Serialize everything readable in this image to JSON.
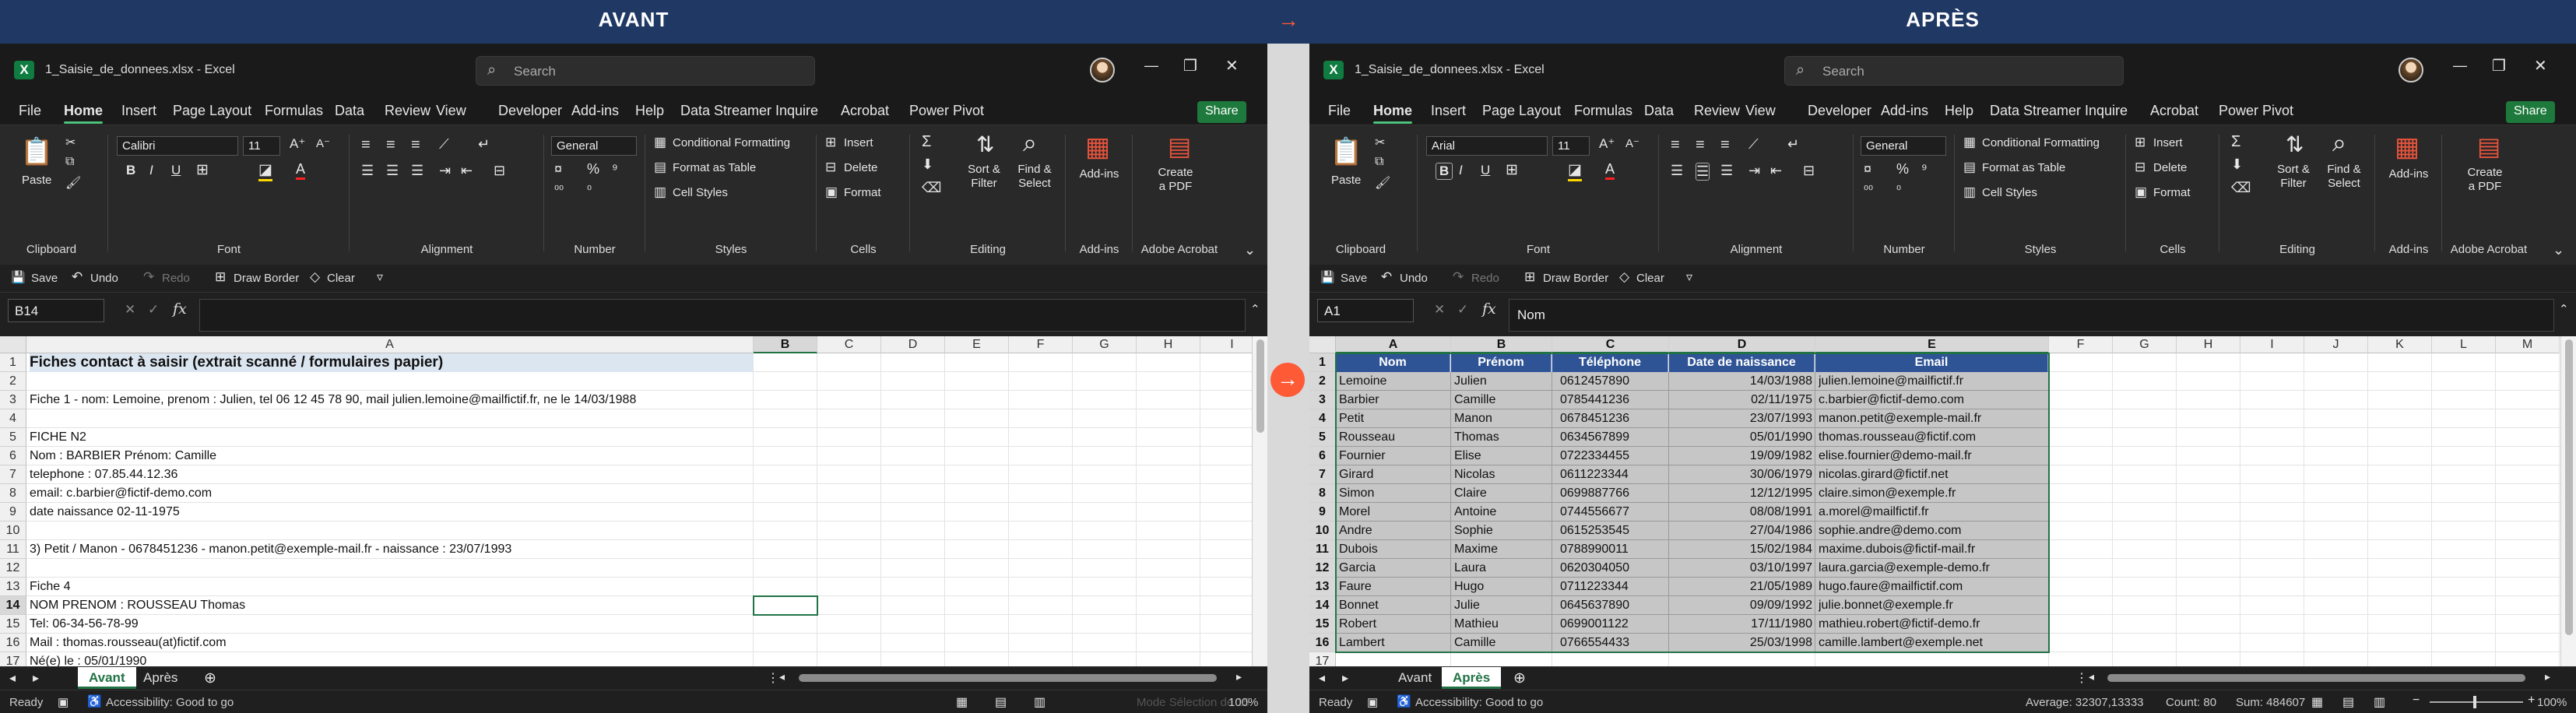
{
  "banner": {
    "before": "AVANT",
    "after": "APRÈS",
    "arrow": "→"
  },
  "shared": {
    "title": "1_Saisie_de_donnees.xlsx  -  Excel",
    "search_placeholder": "Search",
    "menu": [
      "File",
      "Home",
      "Insert",
      "Page Layout",
      "Formulas",
      "Data",
      "Review",
      "View",
      "Developer",
      "Add-ins",
      "Help",
      "Data Streamer",
      "Inquire",
      "Acrobat",
      "Power Pivot"
    ],
    "share": "Share",
    "ribbon": {
      "paste": "Paste",
      "clipboard": "Clipboard",
      "font_group": "Font",
      "alignment": "Alignment",
      "number": "Number",
      "number_format": "General",
      "styles": "Styles",
      "cond_fmt": "Conditional Formatting",
      "fmt_table": "Format as Table",
      "cell_styles": "Cell Styles",
      "cells": "Cells",
      "insert": "Insert",
      "delete": "Delete",
      "format": "Format",
      "editing": "Editing",
      "sort": "Sort &",
      "filter": "Filter",
      "find": "Find &",
      "select": "Select",
      "addins": "Add-ins",
      "create_pdf_1": "Create",
      "create_pdf_2": "a PDF",
      "adobe": "Adobe Acrobat"
    },
    "qat": {
      "save": "Save",
      "undo": "Undo",
      "redo": "Redo",
      "draw_border": "Draw Border",
      "clear": "Clear"
    },
    "fx": "fx",
    "status": {
      "ready": "Ready",
      "accessibility": "Accessibility: Good to go"
    },
    "tab_before": "Avant",
    "tab_after": "Après",
    "zoom": "100%",
    "colors": {
      "excel_green": "#217346",
      "header_blue": "#2f5496",
      "banner": "#1f3864",
      "arrow": "#ff5a36"
    }
  },
  "before": {
    "font": "Calibri",
    "font_size": "11",
    "namebox": "B14",
    "formula": "",
    "columns": [
      "A",
      "B",
      "C",
      "D",
      "E",
      "F",
      "G",
      "H",
      "I"
    ],
    "rows": [
      "1",
      "2",
      "3",
      "4",
      "5",
      "6",
      "7",
      "8",
      "9",
      "10",
      "11",
      "12",
      "13",
      "14",
      "15",
      "16",
      "17",
      "18"
    ],
    "cells": {
      "r1": "Fiches contact à saisir (extrait scanné / formulaires papier)",
      "r3": "Fiche 1 - nom: Lemoine, prenom : Julien, tel 06 12 45 78 90, mail julien.lemoine@mailfictif.fr, ne le 14/03/1988",
      "r5": "FICHE N2",
      "r6": "Nom : BARBIER   Prénom: Camille",
      "r7": "telephone : 07.85.44.12.36",
      "r8": "email: c.barbier@fictif-demo.com",
      "r9": "date naissance 02-11-1975",
      "r11": "3) Petit / Manon - 0678451236 - manon.petit@exemple-mail.fr - naissance : 23/07/1993",
      "r13": "Fiche 4",
      "r14": "NOM PRENOM : ROUSSEAU Thomas",
      "r15": "Tel: 06-34-56-78-99",
      "r16": "Mail : thomas.rousseau(at)fictif.com",
      "r17": "Né(e) le : 05/01/1990"
    },
    "status_extra": "Mode Sélection de 15"
  },
  "after": {
    "font": "Arial",
    "font_size": "11",
    "namebox": "A1",
    "formula": "Nom",
    "columns": [
      "A",
      "B",
      "C",
      "D",
      "E",
      "F",
      "G",
      "H",
      "I",
      "J",
      "K",
      "L",
      "M"
    ],
    "rows": [
      "1",
      "2",
      "3",
      "4",
      "5",
      "6",
      "7",
      "8",
      "9",
      "10",
      "11",
      "12",
      "13",
      "14",
      "15",
      "16",
      "17",
      "18"
    ],
    "headers": [
      "Nom",
      "Prénom",
      "Téléphone",
      "Date de naissance",
      "Email"
    ],
    "records": [
      [
        "Lemoine",
        "Julien",
        "0612457890",
        "14/03/1988",
        "julien.lemoine@mailfictif.fr"
      ],
      [
        "Barbier",
        "Camille",
        "0785441236",
        "02/11/1975",
        "c.barbier@fictif-demo.com"
      ],
      [
        "Petit",
        "Manon",
        "0678451236",
        "23/07/1993",
        "manon.petit@exemple-mail.fr"
      ],
      [
        "Rousseau",
        "Thomas",
        "0634567899",
        "05/01/1990",
        "thomas.rousseau@fictif.com"
      ],
      [
        "Fournier",
        "Elise",
        "0722334455",
        "19/09/1982",
        "elise.fournier@demo-mail.fr"
      ],
      [
        "Girard",
        "Nicolas",
        "0611223344",
        "30/06/1979",
        "nicolas.girard@fictif.net"
      ],
      [
        "Simon",
        "Claire",
        "0699887766",
        "12/12/1995",
        "claire.simon@exemple.fr"
      ],
      [
        "Morel",
        "Antoine",
        "0744556677",
        "08/08/1991",
        "a.morel@mailfictif.fr"
      ],
      [
        "Andre",
        "Sophie",
        "0615253545",
        "27/04/1986",
        "sophie.andre@demo.com"
      ],
      [
        "Dubois",
        "Maxime",
        "0788990011",
        "15/02/1984",
        "maxime.dubois@fictif-mail.fr"
      ],
      [
        "Garcia",
        "Laura",
        "0620304050",
        "03/10/1997",
        "laura.garcia@exemple-demo.fr"
      ],
      [
        "Faure",
        "Hugo",
        "0711223344",
        "21/05/1989",
        "hugo.faure@mailfictif.com"
      ],
      [
        "Bonnet",
        "Julie",
        "0645637890",
        "09/09/1992",
        "julie.bonnet@exemple.fr"
      ],
      [
        "Robert",
        "Mathieu",
        "0699001122",
        "17/11/1980",
        "mathieu.robert@fictif-demo.fr"
      ],
      [
        "Lambert",
        "Camille",
        "0766554433",
        "25/03/1998",
        "camille.lambert@exemple.net"
      ]
    ],
    "status_stats": {
      "average": "Average: 32307,13333",
      "count": "Count: 80",
      "sum": "Sum: 484607"
    }
  }
}
